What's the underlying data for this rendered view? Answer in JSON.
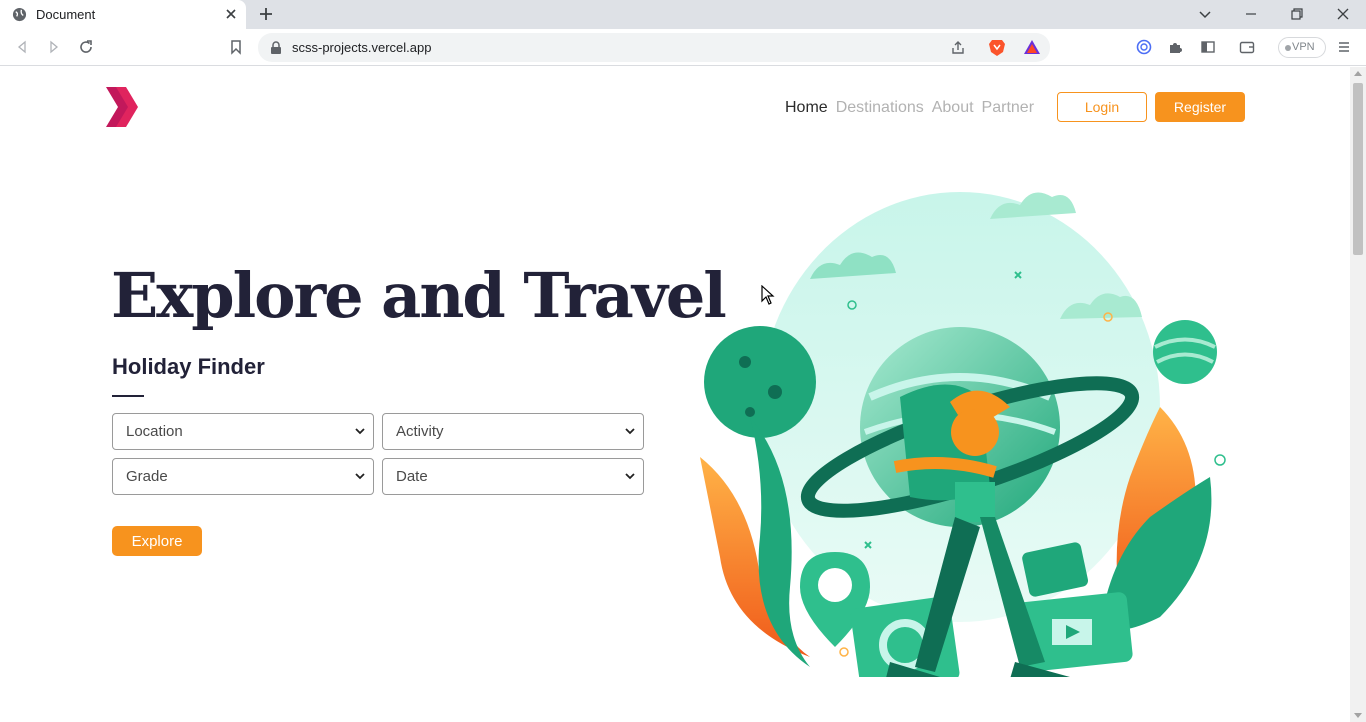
{
  "browser": {
    "tab_title": "Document",
    "url": "scss-projects.vercel.app",
    "vpn_label": "VPN"
  },
  "nav": {
    "items": [
      {
        "label": "Home",
        "active": true
      },
      {
        "label": "Destinations",
        "active": false
      },
      {
        "label": "About",
        "active": false
      },
      {
        "label": "Partner",
        "active": false
      }
    ],
    "login_label": "Login",
    "register_label": "Register"
  },
  "hero": {
    "title": "Explore and Travel",
    "subtitle": "Holiday Finder",
    "selects": [
      {
        "label": "Location"
      },
      {
        "label": "Activity"
      },
      {
        "label": "Grade"
      },
      {
        "label": "Date"
      }
    ],
    "explore_label": "Explore"
  },
  "colors": {
    "accent": "#f7931e",
    "brand": "#e0245e",
    "heading": "#222238",
    "green": "#1fa77a"
  },
  "icons": [
    "globe-icon",
    "close-icon",
    "plus-icon",
    "back-icon",
    "forward-icon",
    "reload-icon",
    "bookmark-icon",
    "lock-icon",
    "share-icon",
    "brave-icon",
    "rewards-icon",
    "extension-icon",
    "puzzle-icon",
    "sidebar-icon",
    "wallet-icon",
    "menu-icon",
    "logo-icon"
  ]
}
